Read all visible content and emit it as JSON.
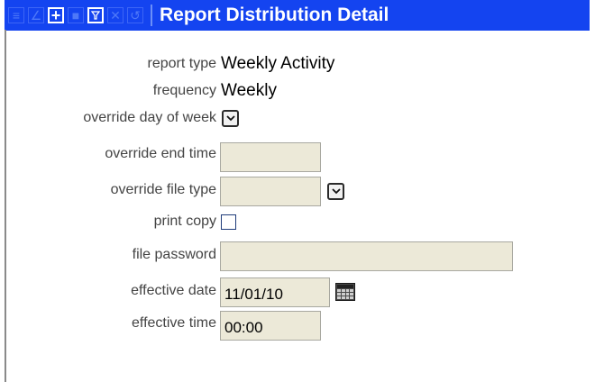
{
  "window": {
    "title": "Report Distribution Detail"
  },
  "toolbar": {
    "icons": [
      "list-icon",
      "edit-icon",
      "add-icon",
      "save-icon",
      "filter-icon",
      "delete-icon",
      "refresh-icon"
    ]
  },
  "form": {
    "report_type": {
      "label": "report type",
      "value": "Weekly Activity"
    },
    "frequency": {
      "label": "frequency",
      "value": "Weekly"
    },
    "override_day_of_week": {
      "label": "override day of week",
      "value": ""
    },
    "override_end_time": {
      "label": "override end time",
      "value": ""
    },
    "override_file_type": {
      "label": "override file type",
      "value": ""
    },
    "print_copy": {
      "label": "print copy",
      "checked": false
    },
    "file_password": {
      "label": "file password",
      "value": ""
    },
    "effective_date": {
      "label": "effective date",
      "value": "11/01/10"
    },
    "effective_time": {
      "label": "effective time",
      "value": "00:00"
    }
  },
  "colors": {
    "titlebar": "#1444f0",
    "input_bg": "#ece9d8",
    "label_text": "#444444"
  }
}
